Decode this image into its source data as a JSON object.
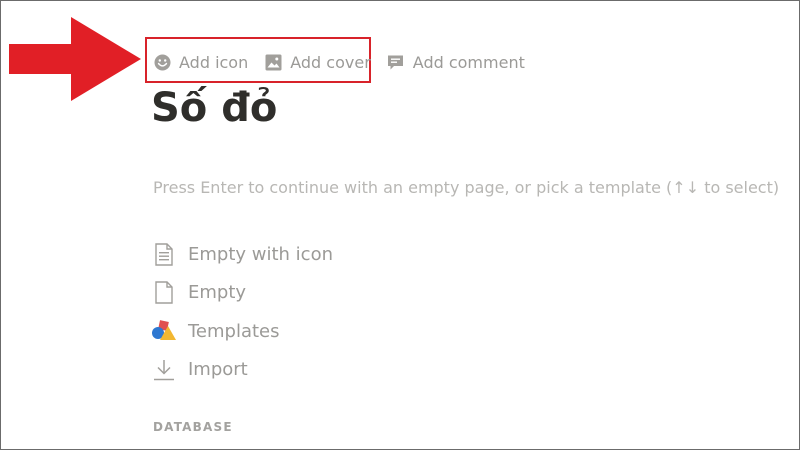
{
  "page_actions": {
    "add_icon_label": "Add icon",
    "add_cover_label": "Add cover",
    "add_comment_label": "Add comment"
  },
  "page": {
    "title": "Số đỏ",
    "hint": "Press Enter to continue with an empty page, or pick a template (↑↓ to select)"
  },
  "options": [
    {
      "label": "Empty with icon",
      "icon": "document-lines-icon"
    },
    {
      "label": "Empty",
      "icon": "blank-document-icon"
    },
    {
      "label": "Templates",
      "icon": "templates-shapes-icon"
    },
    {
      "label": "Import",
      "icon": "download-icon"
    }
  ],
  "section": {
    "database_label": "DATABASE"
  },
  "colors": {
    "annotation_red": "#d8232a",
    "muted_text": "#9b9a97",
    "title_text": "#2f2e2b"
  }
}
